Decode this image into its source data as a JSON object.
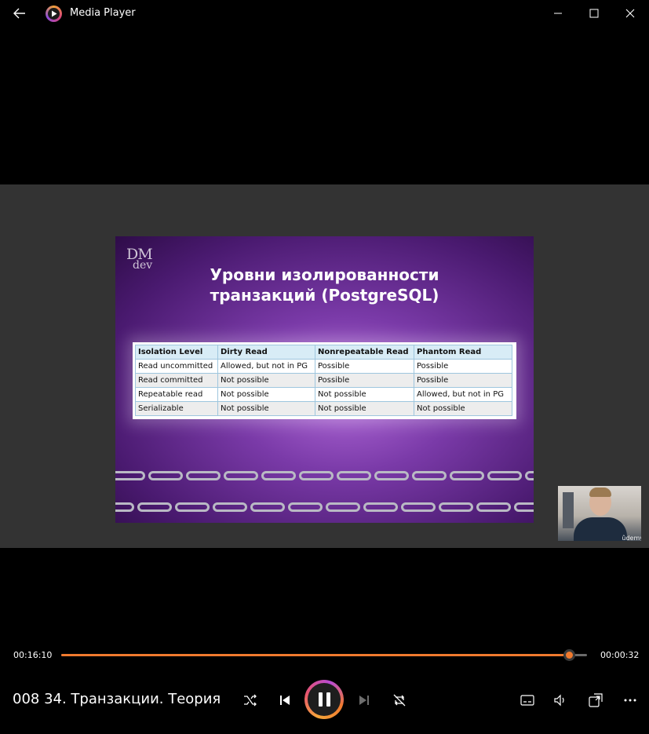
{
  "window": {
    "title": "Media Player"
  },
  "slide": {
    "logo_line1": "DM",
    "logo_line2": "dev",
    "title_line1": "Уровни изолированности",
    "title_line2": "транзакций (PostgreSQL)",
    "table": {
      "headers": [
        "Isolation Level",
        "Dirty Read",
        "Nonrepeatable Read",
        "Phantom Read"
      ],
      "rows": [
        [
          "Read uncommitted",
          "Allowed, but not in PG",
          "Possible",
          "Possible"
        ],
        [
          "Read committed",
          "Not possible",
          "Possible",
          "Possible"
        ],
        [
          "Repeatable read",
          "Not possible",
          "Not possible",
          "Allowed, but not in PG"
        ],
        [
          "Serializable",
          "Not possible",
          "Not possible",
          "Not possible"
        ]
      ]
    }
  },
  "webcam": {
    "watermark": "ûdemy"
  },
  "player": {
    "elapsed": "00:16:10",
    "remaining": "00:00:32",
    "progress_fraction": 0.966,
    "media_title": "008 34. Транзакции. Теория",
    "accent_color": "#f07a2e",
    "icons": [
      "back-arrow-icon",
      "media-player-app-icon",
      "minimize-icon",
      "maximize-icon",
      "close-icon",
      "shuffle-icon",
      "previous-icon",
      "pause-icon",
      "next-icon",
      "repeat-off-icon",
      "subtitles-icon",
      "volume-icon",
      "mini-player-icon",
      "more-options-icon"
    ]
  }
}
